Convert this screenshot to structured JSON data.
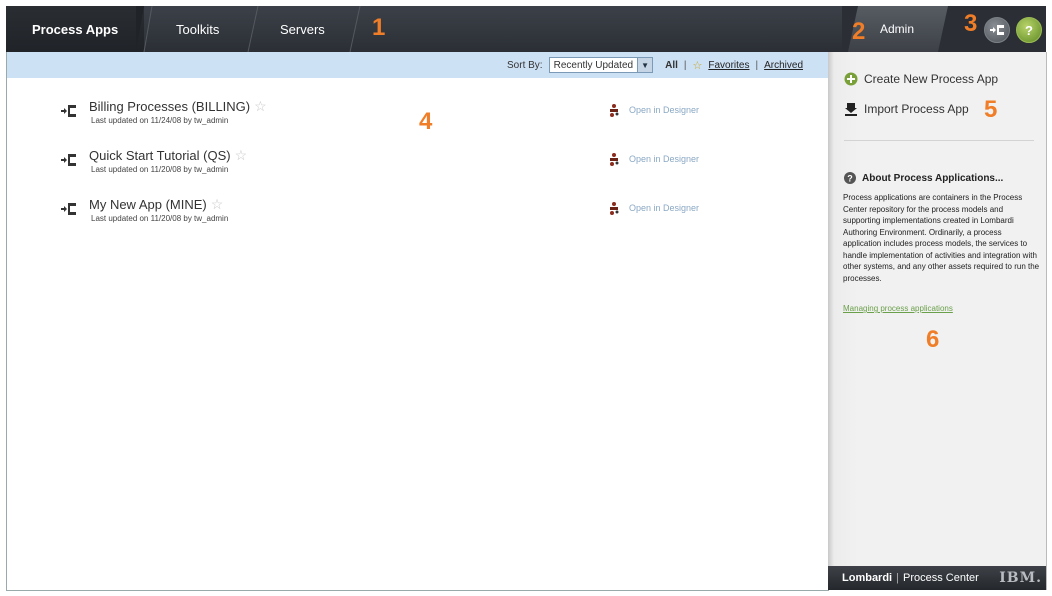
{
  "header": {
    "tabs": [
      {
        "label": "Process Apps",
        "active": true
      },
      {
        "label": "Toolkits",
        "active": false
      },
      {
        "label": "Servers",
        "active": false
      }
    ],
    "admin_label": "Admin",
    "callouts": {
      "one": "1",
      "two": "2",
      "three": "3"
    }
  },
  "sort_bar": {
    "sort_by_label": "Sort By:",
    "selected": "Recently Updated",
    "filter_all": "All",
    "filter_favorites": "Favorites",
    "filter_archived": "Archived"
  },
  "apps": [
    {
      "name": "Billing Processes (BILLING)",
      "updated": "Last updated on 11/24/08 by tw_admin",
      "action": "Open in Designer"
    },
    {
      "name": "Quick Start Tutorial (QS)",
      "updated": "Last updated on 11/20/08 by tw_admin",
      "action": "Open in Designer"
    },
    {
      "name": "My New App (MINE)",
      "updated": "Last updated on 11/20/08 by tw_admin",
      "action": "Open in Designer"
    }
  ],
  "callouts": {
    "four": "4",
    "five": "5",
    "six": "6"
  },
  "sidebar": {
    "create_label": "Create New Process App",
    "import_label": "Import Process App",
    "about_title": "About Process Applications...",
    "about_body": "Process applications are containers in the Process Center repository for the process models and supporting implementations created in Lombardi Authoring Environment. Ordinarily, a process application includes process models, the services to handle implementation of activities and integration with other systems, and any other assets required to run the processes.",
    "about_link": "Managing process applications"
  },
  "footer": {
    "brand": "Lombardi",
    "product": "Process Center",
    "ibm": "IBM."
  },
  "colors": {
    "accent_orange": "#f07d27",
    "header_dark": "#2b2f35",
    "sort_bar_blue": "#cde1f5",
    "link_green": "#6aa04a"
  },
  "icons": [
    "process-app-icon",
    "star-icon",
    "designer-icon",
    "create-plus-icon",
    "import-arrow-icon",
    "help-icon",
    "process-center-icon"
  ]
}
